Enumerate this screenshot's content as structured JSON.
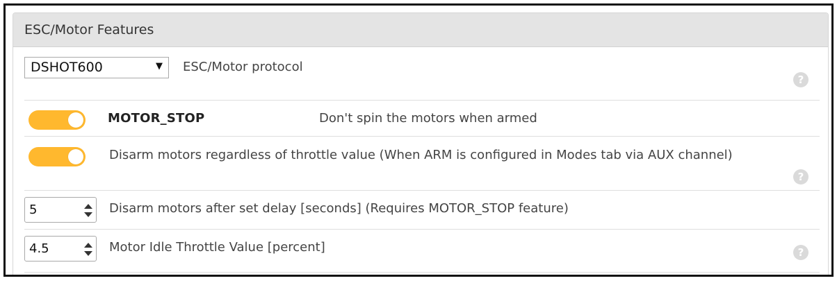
{
  "panel": {
    "title": "ESC/Motor Features"
  },
  "protocol": {
    "selected": "DSHOT600",
    "label": "ESC/Motor protocol"
  },
  "features": [
    {
      "name": "MOTOR_STOP",
      "description": "Don't spin the motors when armed",
      "enabled": true
    },
    {
      "description": "Disarm motors regardless of throttle value (When ARM is configured in Modes tab via AUX channel)",
      "enabled": true
    }
  ],
  "inputs": [
    {
      "value": "5",
      "label": "Disarm motors after set delay [seconds] (Requires MOTOR_STOP feature)"
    },
    {
      "value": "4.5",
      "label": "Motor Idle Throttle Value [percent]"
    }
  ],
  "help_glyph": "?",
  "colors": {
    "toggle_on": "#ffb82e",
    "header_bg": "#e4e4e4",
    "help_icon": "#dadada"
  }
}
